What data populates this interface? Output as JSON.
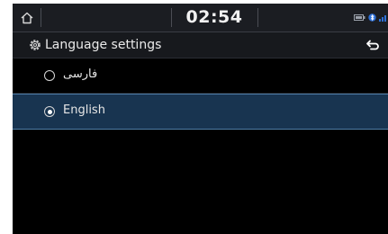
{
  "status_bar": {
    "home_icon": "home-icon",
    "time": "02:54",
    "icons": [
      "battery-icon",
      "bluetooth-icon",
      "signal-icon"
    ]
  },
  "header": {
    "icon": "gear-icon",
    "title": "Language settings",
    "back_icon": "back-arrow-icon"
  },
  "languages": [
    {
      "label": "فارسی",
      "selected": false
    },
    {
      "label": "English",
      "selected": true
    }
  ],
  "colors": {
    "selected_bg": "#183450",
    "selected_border": "#4f7ea8",
    "bar_bg": "#1b1d22"
  }
}
